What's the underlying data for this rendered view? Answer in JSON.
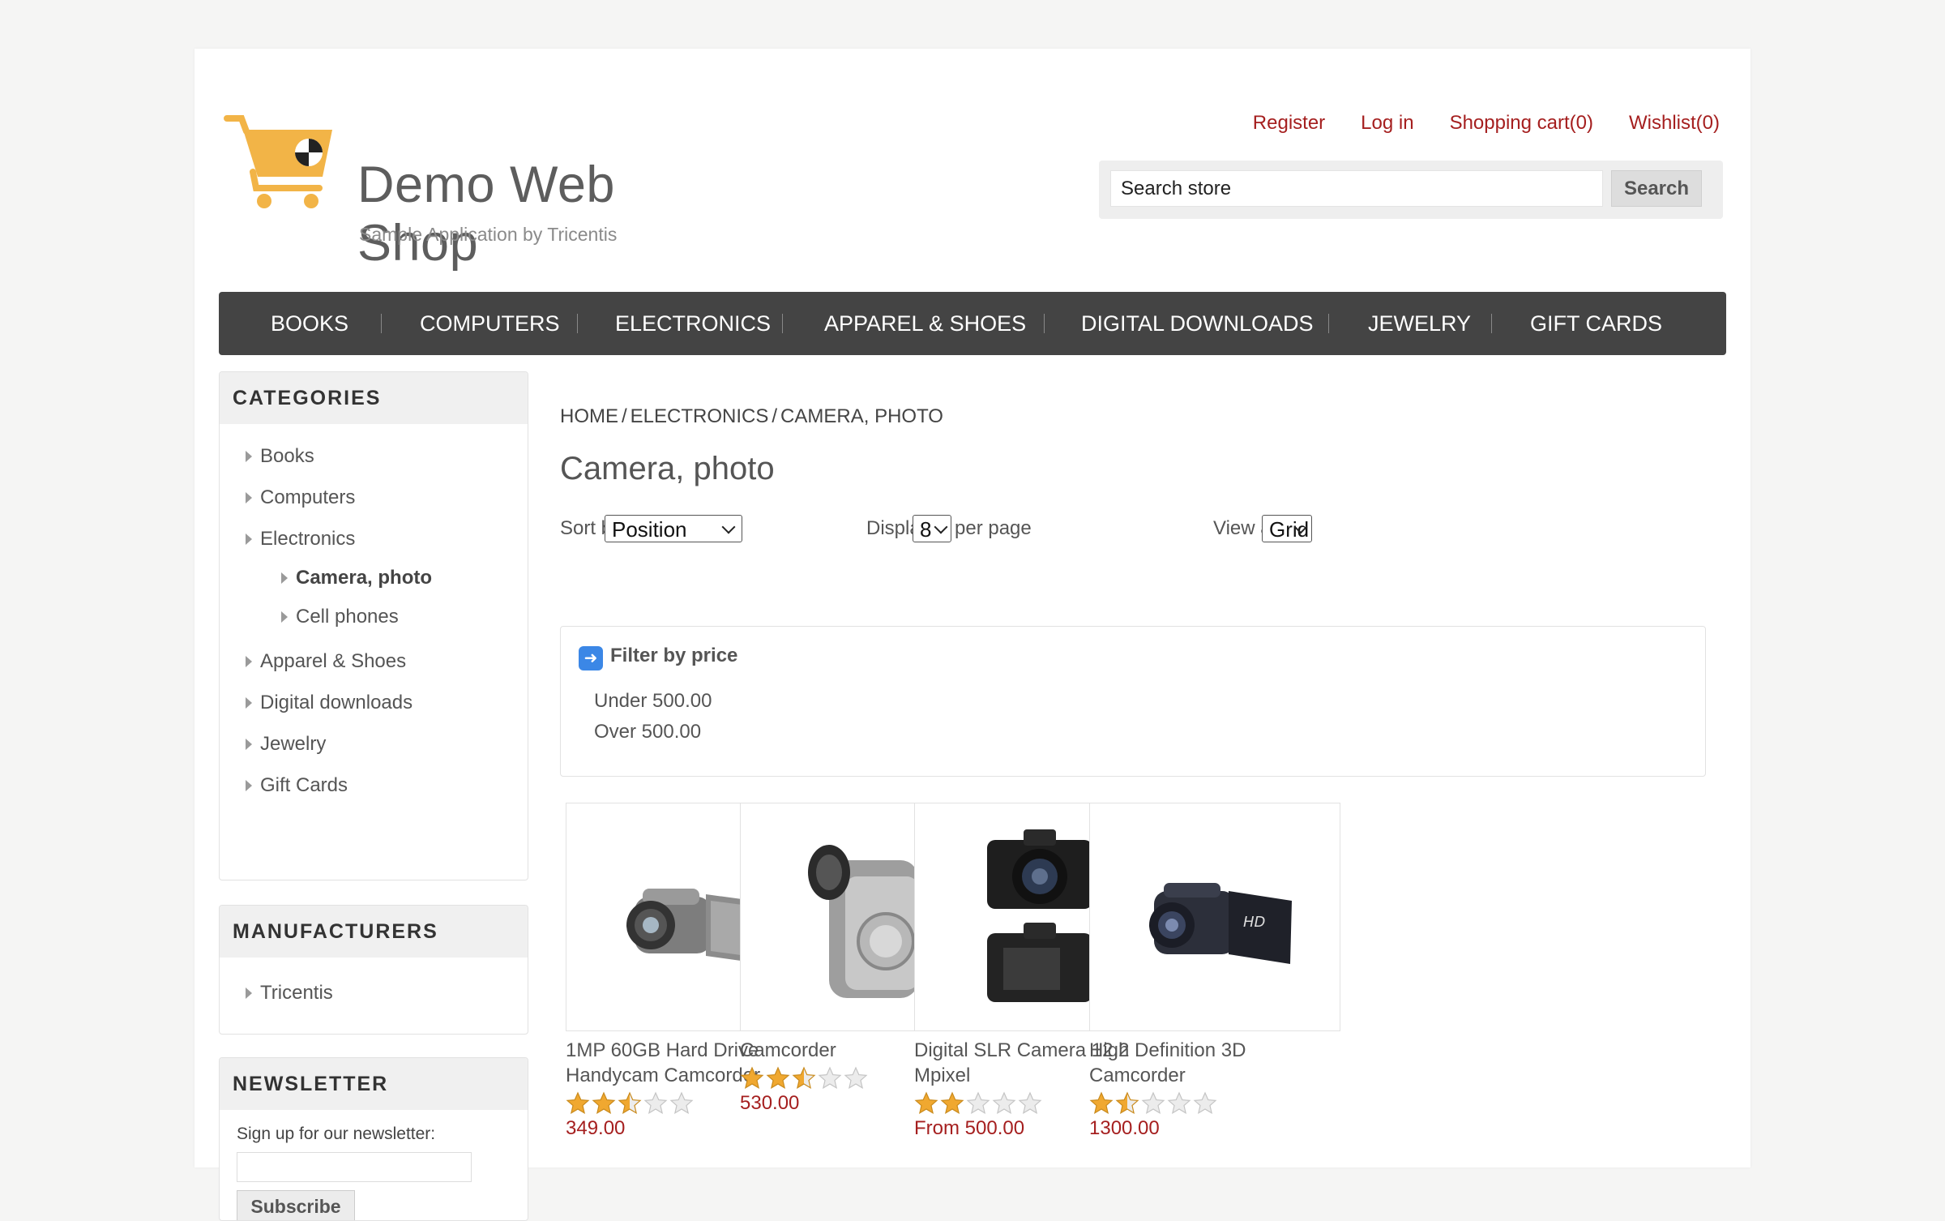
{
  "header": {
    "logo_title": "Demo Web Shop",
    "logo_subtitle": "Sample Application by Tricentis",
    "links": [
      "Register",
      "Log in",
      "Shopping cart(0)",
      "Wishlist(0)"
    ],
    "search_placeholder": "Search store",
    "search_button": "Search"
  },
  "topmenu": [
    "Books",
    "Computers",
    "Electronics",
    "Apparel & Shoes",
    "Digital downloads",
    "Jewelry",
    "Gift Cards"
  ],
  "categories": {
    "title": "Categories",
    "items": [
      "Books",
      "Computers",
      "Electronics",
      "Camera, photo",
      "Cell phones",
      "Apparel & Shoes",
      "Digital downloads",
      "Jewelry",
      "Gift Cards"
    ]
  },
  "manufacturers": {
    "title": "Manufacturers",
    "items": [
      "Tricentis"
    ]
  },
  "newsletter": {
    "title": "Newsletter",
    "label": "Sign up for our newsletter:",
    "button": "Subscribe"
  },
  "breadcrumb": [
    "Home",
    "Electronics",
    "Camera, photo"
  ],
  "page_title": "Camera, photo",
  "controls": {
    "sort_label": "Sort by",
    "sort_value": "Position",
    "display_label": "Display",
    "display_value": "8",
    "per_page": "per page",
    "view_label": "View as",
    "view_value": "Grid"
  },
  "filter": {
    "title": "Filter by price",
    "options": [
      "Under 500.00",
      "Over 500.00"
    ]
  },
  "products": [
    {
      "name": "1MP 60GB Hard Drive Handycam Camcorder",
      "price": "349.00",
      "rating": 2.5,
      "image": "handycam-image"
    },
    {
      "name": "Camcorder",
      "price": "530.00",
      "rating": 2.5,
      "image": "camcorder-image"
    },
    {
      "name": "Digital SLR Camera 12.2 Mpixel",
      "price": "From 500.00",
      "rating": 2,
      "image": "dslr-image"
    },
    {
      "name": "High Definition 3D Camcorder",
      "price": "1300.00",
      "rating": 1.5,
      "image": "hd-camcorder-image"
    }
  ],
  "colors": {
    "accent_red": "#a51f1f",
    "menu_bg": "#444444",
    "star": "#f0a830"
  }
}
